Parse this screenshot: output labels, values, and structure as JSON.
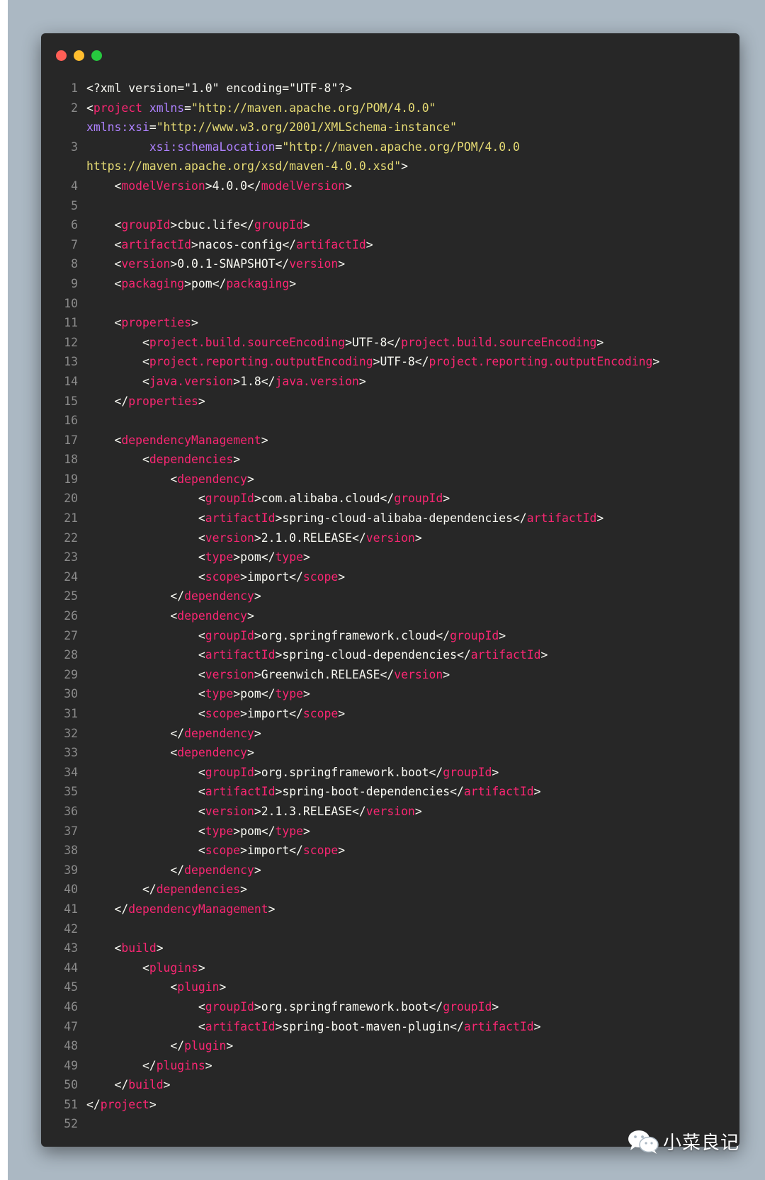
{
  "window": {
    "dots": [
      "#ff5f56",
      "#ffbd2e",
      "#27c93f"
    ]
  },
  "code_lines": [
    {
      "n": "1",
      "tokens": [
        {
          "c": "p",
          "v": "<?xml version=\"1.0\" encoding=\"UTF-8\"?>"
        }
      ]
    },
    {
      "n": "2",
      "wrap": true,
      "tokens": [
        {
          "c": "p",
          "v": "<"
        },
        {
          "c": "t",
          "v": "project"
        },
        {
          "c": "p",
          "v": " "
        },
        {
          "c": "a",
          "v": "xmlns"
        },
        {
          "c": "p",
          "v": "="
        },
        {
          "c": "s",
          "v": "\"http://maven.apache.org/POM/4.0.0\""
        },
        {
          "c": "p",
          "v": "\n"
        },
        {
          "c": "a",
          "v": "xmlns:xsi"
        },
        {
          "c": "p",
          "v": "="
        },
        {
          "c": "s",
          "v": "\"http://www.w3.org/2001/XMLSchema-instance\""
        }
      ]
    },
    {
      "n": "3",
      "wrap": true,
      "tokens": [
        {
          "c": "p",
          "v": "         "
        },
        {
          "c": "a",
          "v": "xsi:schemaLocation"
        },
        {
          "c": "p",
          "v": "="
        },
        {
          "c": "s",
          "v": "\"http://maven.apache.org/POM/4.0.0\nhttps://maven.apache.org/xsd/maven-4.0.0.xsd\""
        },
        {
          "c": "p",
          "v": ">"
        }
      ]
    },
    {
      "n": "4",
      "tokens": [
        {
          "c": "p",
          "v": "    <"
        },
        {
          "c": "t",
          "v": "modelVersion"
        },
        {
          "c": "p",
          "v": ">4.0.0</"
        },
        {
          "c": "t",
          "v": "modelVersion"
        },
        {
          "c": "p",
          "v": ">"
        }
      ]
    },
    {
      "n": "5",
      "tokens": []
    },
    {
      "n": "6",
      "tokens": [
        {
          "c": "p",
          "v": "    <"
        },
        {
          "c": "t",
          "v": "groupId"
        },
        {
          "c": "p",
          "v": ">cbuc.life</"
        },
        {
          "c": "t",
          "v": "groupId"
        },
        {
          "c": "p",
          "v": ">"
        }
      ]
    },
    {
      "n": "7",
      "tokens": [
        {
          "c": "p",
          "v": "    <"
        },
        {
          "c": "t",
          "v": "artifactId"
        },
        {
          "c": "p",
          "v": ">nacos-config</"
        },
        {
          "c": "t",
          "v": "artifactId"
        },
        {
          "c": "p",
          "v": ">"
        }
      ]
    },
    {
      "n": "8",
      "tokens": [
        {
          "c": "p",
          "v": "    <"
        },
        {
          "c": "t",
          "v": "version"
        },
        {
          "c": "p",
          "v": ">0.0.1-SNAPSHOT</"
        },
        {
          "c": "t",
          "v": "version"
        },
        {
          "c": "p",
          "v": ">"
        }
      ]
    },
    {
      "n": "9",
      "tokens": [
        {
          "c": "p",
          "v": "    <"
        },
        {
          "c": "t",
          "v": "packaging"
        },
        {
          "c": "p",
          "v": ">pom</"
        },
        {
          "c": "t",
          "v": "packaging"
        },
        {
          "c": "p",
          "v": ">"
        }
      ]
    },
    {
      "n": "10",
      "tokens": []
    },
    {
      "n": "11",
      "tokens": [
        {
          "c": "p",
          "v": "    <"
        },
        {
          "c": "t",
          "v": "properties"
        },
        {
          "c": "p",
          "v": ">"
        }
      ]
    },
    {
      "n": "12",
      "tokens": [
        {
          "c": "p",
          "v": "        <"
        },
        {
          "c": "t",
          "v": "project.build.sourceEncoding"
        },
        {
          "c": "p",
          "v": ">UTF-8</"
        },
        {
          "c": "t",
          "v": "project.build.sourceEncoding"
        },
        {
          "c": "p",
          "v": ">"
        }
      ]
    },
    {
      "n": "13",
      "tokens": [
        {
          "c": "p",
          "v": "        <"
        },
        {
          "c": "t",
          "v": "project.reporting.outputEncoding"
        },
        {
          "c": "p",
          "v": ">UTF-8</"
        },
        {
          "c": "t",
          "v": "project.reporting.outputEncoding"
        },
        {
          "c": "p",
          "v": ">"
        }
      ]
    },
    {
      "n": "14",
      "tokens": [
        {
          "c": "p",
          "v": "        <"
        },
        {
          "c": "t",
          "v": "java.version"
        },
        {
          "c": "p",
          "v": ">1.8</"
        },
        {
          "c": "t",
          "v": "java.version"
        },
        {
          "c": "p",
          "v": ">"
        }
      ]
    },
    {
      "n": "15",
      "tokens": [
        {
          "c": "p",
          "v": "    </"
        },
        {
          "c": "t",
          "v": "properties"
        },
        {
          "c": "p",
          "v": ">"
        }
      ]
    },
    {
      "n": "16",
      "tokens": []
    },
    {
      "n": "17",
      "tokens": [
        {
          "c": "p",
          "v": "    <"
        },
        {
          "c": "t",
          "v": "dependencyManagement"
        },
        {
          "c": "p",
          "v": ">"
        }
      ]
    },
    {
      "n": "18",
      "tokens": [
        {
          "c": "p",
          "v": "        <"
        },
        {
          "c": "t",
          "v": "dependencies"
        },
        {
          "c": "p",
          "v": ">"
        }
      ]
    },
    {
      "n": "19",
      "tokens": [
        {
          "c": "p",
          "v": "            <"
        },
        {
          "c": "t",
          "v": "dependency"
        },
        {
          "c": "p",
          "v": ">"
        }
      ]
    },
    {
      "n": "20",
      "tokens": [
        {
          "c": "p",
          "v": "                <"
        },
        {
          "c": "t",
          "v": "groupId"
        },
        {
          "c": "p",
          "v": ">com.alibaba.cloud</"
        },
        {
          "c": "t",
          "v": "groupId"
        },
        {
          "c": "p",
          "v": ">"
        }
      ]
    },
    {
      "n": "21",
      "tokens": [
        {
          "c": "p",
          "v": "                <"
        },
        {
          "c": "t",
          "v": "artifactId"
        },
        {
          "c": "p",
          "v": ">spring-cloud-alibaba-dependencies</"
        },
        {
          "c": "t",
          "v": "artifactId"
        },
        {
          "c": "p",
          "v": ">"
        }
      ]
    },
    {
      "n": "22",
      "tokens": [
        {
          "c": "p",
          "v": "                <"
        },
        {
          "c": "t",
          "v": "version"
        },
        {
          "c": "p",
          "v": ">2.1.0.RELEASE</"
        },
        {
          "c": "t",
          "v": "version"
        },
        {
          "c": "p",
          "v": ">"
        }
      ]
    },
    {
      "n": "23",
      "tokens": [
        {
          "c": "p",
          "v": "                <"
        },
        {
          "c": "t",
          "v": "type"
        },
        {
          "c": "p",
          "v": ">pom</"
        },
        {
          "c": "t",
          "v": "type"
        },
        {
          "c": "p",
          "v": ">"
        }
      ]
    },
    {
      "n": "24",
      "tokens": [
        {
          "c": "p",
          "v": "                <"
        },
        {
          "c": "t",
          "v": "scope"
        },
        {
          "c": "p",
          "v": ">import</"
        },
        {
          "c": "t",
          "v": "scope"
        },
        {
          "c": "p",
          "v": ">"
        }
      ]
    },
    {
      "n": "25",
      "tokens": [
        {
          "c": "p",
          "v": "            </"
        },
        {
          "c": "t",
          "v": "dependency"
        },
        {
          "c": "p",
          "v": ">"
        }
      ]
    },
    {
      "n": "26",
      "tokens": [
        {
          "c": "p",
          "v": "            <"
        },
        {
          "c": "t",
          "v": "dependency"
        },
        {
          "c": "p",
          "v": ">"
        }
      ]
    },
    {
      "n": "27",
      "tokens": [
        {
          "c": "p",
          "v": "                <"
        },
        {
          "c": "t",
          "v": "groupId"
        },
        {
          "c": "p",
          "v": ">org.springframework.cloud</"
        },
        {
          "c": "t",
          "v": "groupId"
        },
        {
          "c": "p",
          "v": ">"
        }
      ]
    },
    {
      "n": "28",
      "tokens": [
        {
          "c": "p",
          "v": "                <"
        },
        {
          "c": "t",
          "v": "artifactId"
        },
        {
          "c": "p",
          "v": ">spring-cloud-dependencies</"
        },
        {
          "c": "t",
          "v": "artifactId"
        },
        {
          "c": "p",
          "v": ">"
        }
      ]
    },
    {
      "n": "29",
      "tokens": [
        {
          "c": "p",
          "v": "                <"
        },
        {
          "c": "t",
          "v": "version"
        },
        {
          "c": "p",
          "v": ">Greenwich.RELEASE</"
        },
        {
          "c": "t",
          "v": "version"
        },
        {
          "c": "p",
          "v": ">"
        }
      ]
    },
    {
      "n": "30",
      "tokens": [
        {
          "c": "p",
          "v": "                <"
        },
        {
          "c": "t",
          "v": "type"
        },
        {
          "c": "p",
          "v": ">pom</"
        },
        {
          "c": "t",
          "v": "type"
        },
        {
          "c": "p",
          "v": ">"
        }
      ]
    },
    {
      "n": "31",
      "tokens": [
        {
          "c": "p",
          "v": "                <"
        },
        {
          "c": "t",
          "v": "scope"
        },
        {
          "c": "p",
          "v": ">import</"
        },
        {
          "c": "t",
          "v": "scope"
        },
        {
          "c": "p",
          "v": ">"
        }
      ]
    },
    {
      "n": "32",
      "tokens": [
        {
          "c": "p",
          "v": "            </"
        },
        {
          "c": "t",
          "v": "dependency"
        },
        {
          "c": "p",
          "v": ">"
        }
      ]
    },
    {
      "n": "33",
      "tokens": [
        {
          "c": "p",
          "v": "            <"
        },
        {
          "c": "t",
          "v": "dependency"
        },
        {
          "c": "p",
          "v": ">"
        }
      ]
    },
    {
      "n": "34",
      "tokens": [
        {
          "c": "p",
          "v": "                <"
        },
        {
          "c": "t",
          "v": "groupId"
        },
        {
          "c": "p",
          "v": ">org.springframework.boot</"
        },
        {
          "c": "t",
          "v": "groupId"
        },
        {
          "c": "p",
          "v": ">"
        }
      ]
    },
    {
      "n": "35",
      "tokens": [
        {
          "c": "p",
          "v": "                <"
        },
        {
          "c": "t",
          "v": "artifactId"
        },
        {
          "c": "p",
          "v": ">spring-boot-dependencies</"
        },
        {
          "c": "t",
          "v": "artifactId"
        },
        {
          "c": "p",
          "v": ">"
        }
      ]
    },
    {
      "n": "36",
      "tokens": [
        {
          "c": "p",
          "v": "                <"
        },
        {
          "c": "t",
          "v": "version"
        },
        {
          "c": "p",
          "v": ">2.1.3.RELEASE</"
        },
        {
          "c": "t",
          "v": "version"
        },
        {
          "c": "p",
          "v": ">"
        }
      ]
    },
    {
      "n": "37",
      "tokens": [
        {
          "c": "p",
          "v": "                <"
        },
        {
          "c": "t",
          "v": "type"
        },
        {
          "c": "p",
          "v": ">pom</"
        },
        {
          "c": "t",
          "v": "type"
        },
        {
          "c": "p",
          "v": ">"
        }
      ]
    },
    {
      "n": "38",
      "tokens": [
        {
          "c": "p",
          "v": "                <"
        },
        {
          "c": "t",
          "v": "scope"
        },
        {
          "c": "p",
          "v": ">import</"
        },
        {
          "c": "t",
          "v": "scope"
        },
        {
          "c": "p",
          "v": ">"
        }
      ]
    },
    {
      "n": "39",
      "tokens": [
        {
          "c": "p",
          "v": "            </"
        },
        {
          "c": "t",
          "v": "dependency"
        },
        {
          "c": "p",
          "v": ">"
        }
      ]
    },
    {
      "n": "40",
      "tokens": [
        {
          "c": "p",
          "v": "        </"
        },
        {
          "c": "t",
          "v": "dependencies"
        },
        {
          "c": "p",
          "v": ">"
        }
      ]
    },
    {
      "n": "41",
      "tokens": [
        {
          "c": "p",
          "v": "    </"
        },
        {
          "c": "t",
          "v": "dependencyManagement"
        },
        {
          "c": "p",
          "v": ">"
        }
      ]
    },
    {
      "n": "42",
      "tokens": []
    },
    {
      "n": "43",
      "tokens": [
        {
          "c": "p",
          "v": "    <"
        },
        {
          "c": "t",
          "v": "build"
        },
        {
          "c": "p",
          "v": ">"
        }
      ]
    },
    {
      "n": "44",
      "tokens": [
        {
          "c": "p",
          "v": "        <"
        },
        {
          "c": "t",
          "v": "plugins"
        },
        {
          "c": "p",
          "v": ">"
        }
      ]
    },
    {
      "n": "45",
      "tokens": [
        {
          "c": "p",
          "v": "            <"
        },
        {
          "c": "t",
          "v": "plugin"
        },
        {
          "c": "p",
          "v": ">"
        }
      ]
    },
    {
      "n": "46",
      "tokens": [
        {
          "c": "p",
          "v": "                <"
        },
        {
          "c": "t",
          "v": "groupId"
        },
        {
          "c": "p",
          "v": ">org.springframework.boot</"
        },
        {
          "c": "t",
          "v": "groupId"
        },
        {
          "c": "p",
          "v": ">"
        }
      ]
    },
    {
      "n": "47",
      "tokens": [
        {
          "c": "p",
          "v": "                <"
        },
        {
          "c": "t",
          "v": "artifactId"
        },
        {
          "c": "p",
          "v": ">spring-boot-maven-plugin</"
        },
        {
          "c": "t",
          "v": "artifactId"
        },
        {
          "c": "p",
          "v": ">"
        }
      ]
    },
    {
      "n": "48",
      "tokens": [
        {
          "c": "p",
          "v": "            </"
        },
        {
          "c": "t",
          "v": "plugin"
        },
        {
          "c": "p",
          "v": ">"
        }
      ]
    },
    {
      "n": "49",
      "tokens": [
        {
          "c": "p",
          "v": "        </"
        },
        {
          "c": "t",
          "v": "plugins"
        },
        {
          "c": "p",
          "v": ">"
        }
      ]
    },
    {
      "n": "50",
      "tokens": [
        {
          "c": "p",
          "v": "    </"
        },
        {
          "c": "t",
          "v": "build"
        },
        {
          "c": "p",
          "v": ">"
        }
      ]
    },
    {
      "n": "51",
      "tokens": [
        {
          "c": "p",
          "v": "</"
        },
        {
          "c": "t",
          "v": "project"
        },
        {
          "c": "p",
          "v": ">"
        }
      ]
    },
    {
      "n": "52",
      "tokens": []
    }
  ],
  "syntax_colors": {
    "tag": "#f92672",
    "attribute": "#ae81ff",
    "string": "#e6db74",
    "plain": "#f8f8f2",
    "line_number": "#8b8b8b",
    "background": "#272727"
  },
  "watermark": {
    "icon": "wechat-icon",
    "text": "小菜良记"
  }
}
